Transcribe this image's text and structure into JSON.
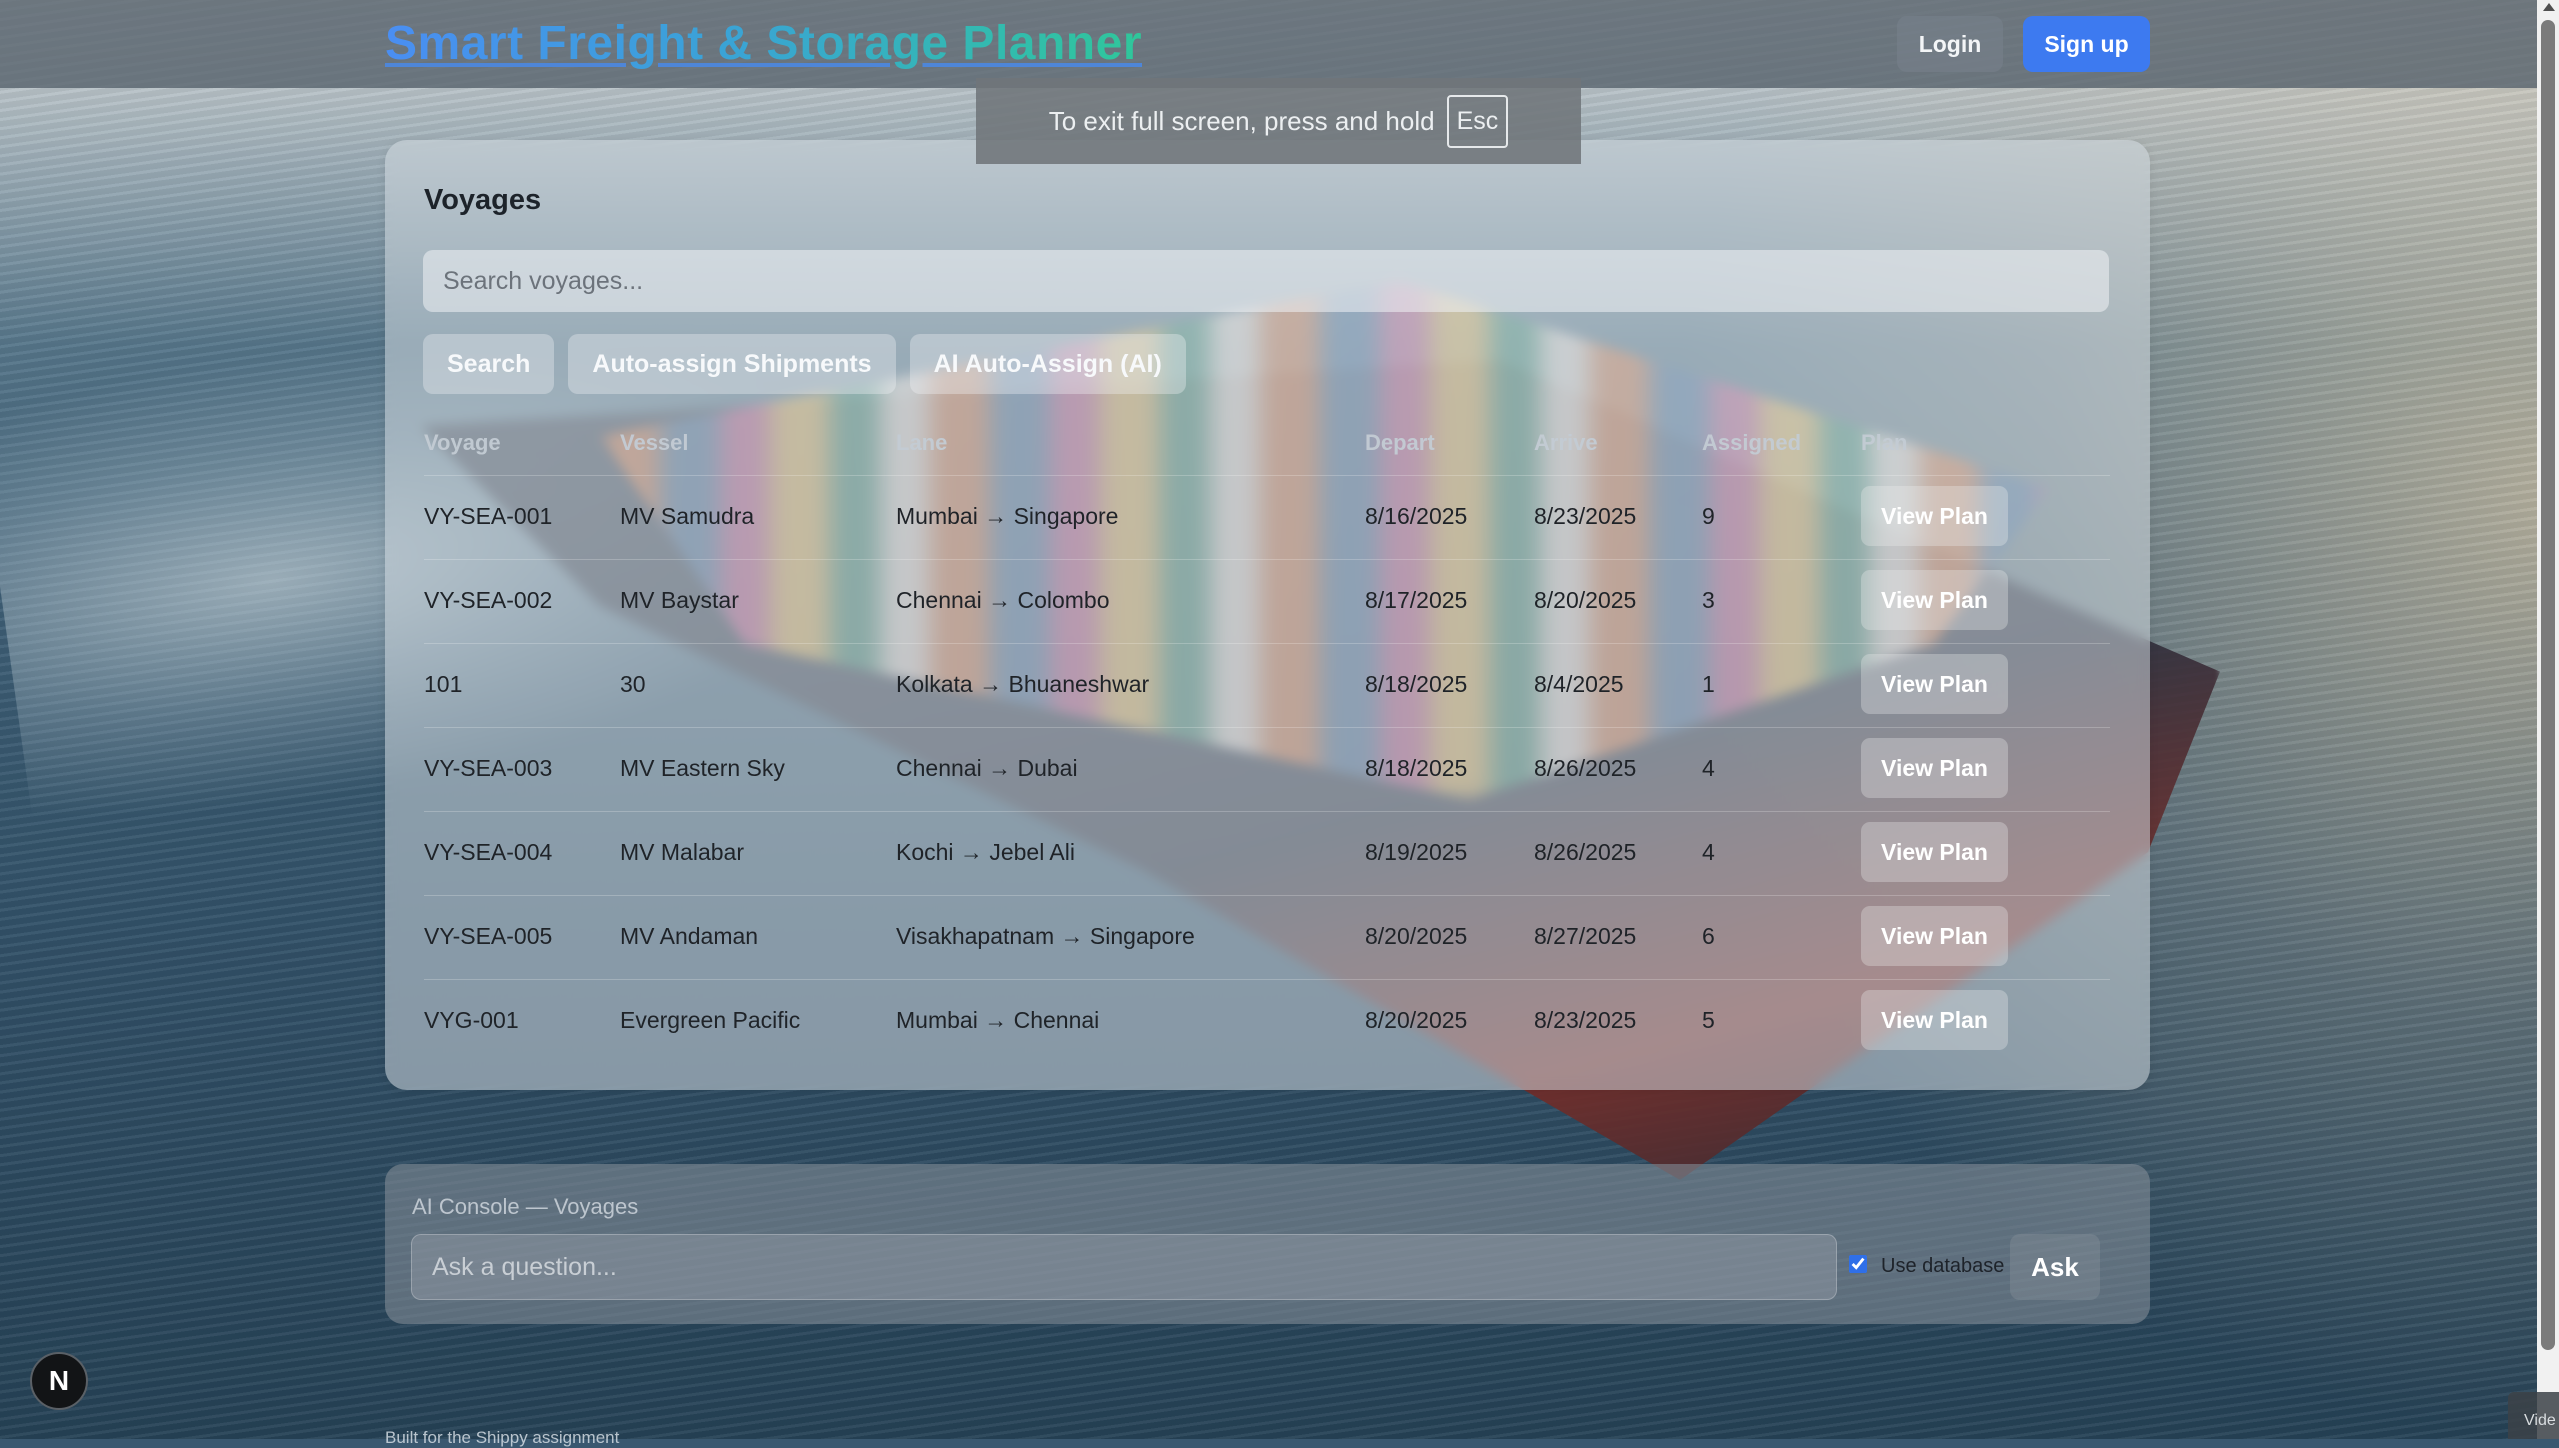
{
  "app": {
    "title": "Smart Freight & Storage Planner",
    "login_label": "Login",
    "signup_label": "Sign up"
  },
  "fullscreen_toast": {
    "message": "To exit full screen, press and hold",
    "key": "Esc"
  },
  "voyages": {
    "title": "Voyages",
    "search_placeholder": "Search voyages...",
    "actions": {
      "search": "Search",
      "auto_assign": "Auto-assign Shipments",
      "ai_auto_assign": "AI Auto-Assign (AI)"
    },
    "columns": [
      "Voyage",
      "Vessel",
      "Lane",
      "Depart",
      "Arrive",
      "Assigned",
      "Plan"
    ],
    "view_plan_label": "View Plan",
    "rows": [
      {
        "voyage": "VY-SEA-001",
        "vessel": "MV Samudra",
        "lane": "Mumbai → Singapore",
        "depart": "8/16/2025",
        "arrive": "8/23/2025",
        "assigned": "9"
      },
      {
        "voyage": "VY-SEA-002",
        "vessel": "MV Baystar",
        "lane": "Chennai → Colombo",
        "depart": "8/17/2025",
        "arrive": "8/20/2025",
        "assigned": "3"
      },
      {
        "voyage": "101",
        "vessel": "30",
        "lane": "Kolkata → Bhuaneshwar",
        "depart": "8/18/2025",
        "arrive": "8/4/2025",
        "assigned": "1"
      },
      {
        "voyage": "VY-SEA-003",
        "vessel": "MV Eastern Sky",
        "lane": "Chennai → Dubai",
        "depart": "8/18/2025",
        "arrive": "8/26/2025",
        "assigned": "4"
      },
      {
        "voyage": "VY-SEA-004",
        "vessel": "MV Malabar",
        "lane": "Kochi → Jebel Ali",
        "depart": "8/19/2025",
        "arrive": "8/26/2025",
        "assigned": "4"
      },
      {
        "voyage": "VY-SEA-005",
        "vessel": "MV Andaman",
        "lane": "Visakhapatnam → Singapore",
        "depart": "8/20/2025",
        "arrive": "8/27/2025",
        "assigned": "6"
      },
      {
        "voyage": "VYG-001",
        "vessel": "Evergreen Pacific",
        "lane": "Mumbai → Chennai",
        "depart": "8/20/2025",
        "arrive": "8/23/2025",
        "assigned": "5"
      }
    ]
  },
  "ai_console": {
    "title": "AI Console — Voyages",
    "input_placeholder": "Ask a question...",
    "use_database_label": "Use database",
    "use_database_checked": true,
    "ask_label": "Ask"
  },
  "badge": {
    "letter": "N"
  },
  "footer": {
    "text": "Built for the Shippy assignment"
  },
  "video_tab": {
    "label": "Vide"
  },
  "colors": {
    "accent": "#3d7af0",
    "brand_gradient_start": "#4a8ef2",
    "brand_gradient_end": "#2fc79a"
  }
}
